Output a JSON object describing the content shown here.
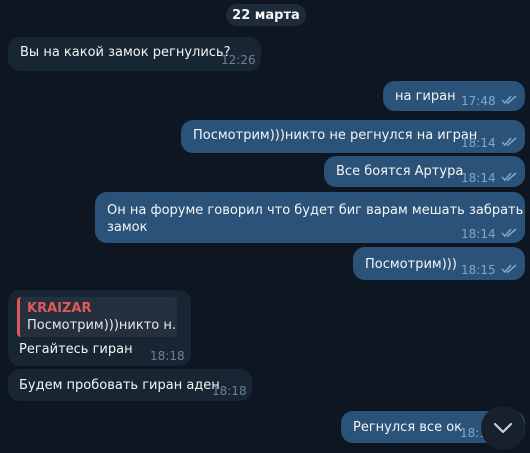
{
  "date_label": "22 марта",
  "messages": [
    {
      "text": "Вы на какой замок регнулись?",
      "time": "12:26"
    },
    {
      "text": "на гиран",
      "time": "17:48"
    },
    {
      "text": "Посмотрим)))никто не регнулся на игран",
      "time": "18:14"
    },
    {
      "text": "Все боятся Артура",
      "time": "18:14"
    },
    {
      "text_line1": "Он на форуме говорил что будет биг варам мешать забрать",
      "text_line2": "замок",
      "time": "18:14"
    },
    {
      "text": "Посмотрим)))",
      "time": "18:15"
    },
    {
      "reply_name": "KRAIZAR",
      "reply_text": "Посмотрим)))никто н...",
      "text": "Регайтесь гиран",
      "time": "18:18"
    },
    {
      "text": "Будем пробовать гиран аден",
      "time": "18:18"
    },
    {
      "text": "Регнулся все ок",
      "time": "18:1"
    }
  ],
  "icons": {
    "read_receipt": "double-check-icon",
    "scroll_down": "chevron-down-icon"
  },
  "colors": {
    "background": "#0e1621",
    "incoming": "#182533",
    "outgoing": "#2b5278",
    "reply_accent": "#e0585c"
  }
}
